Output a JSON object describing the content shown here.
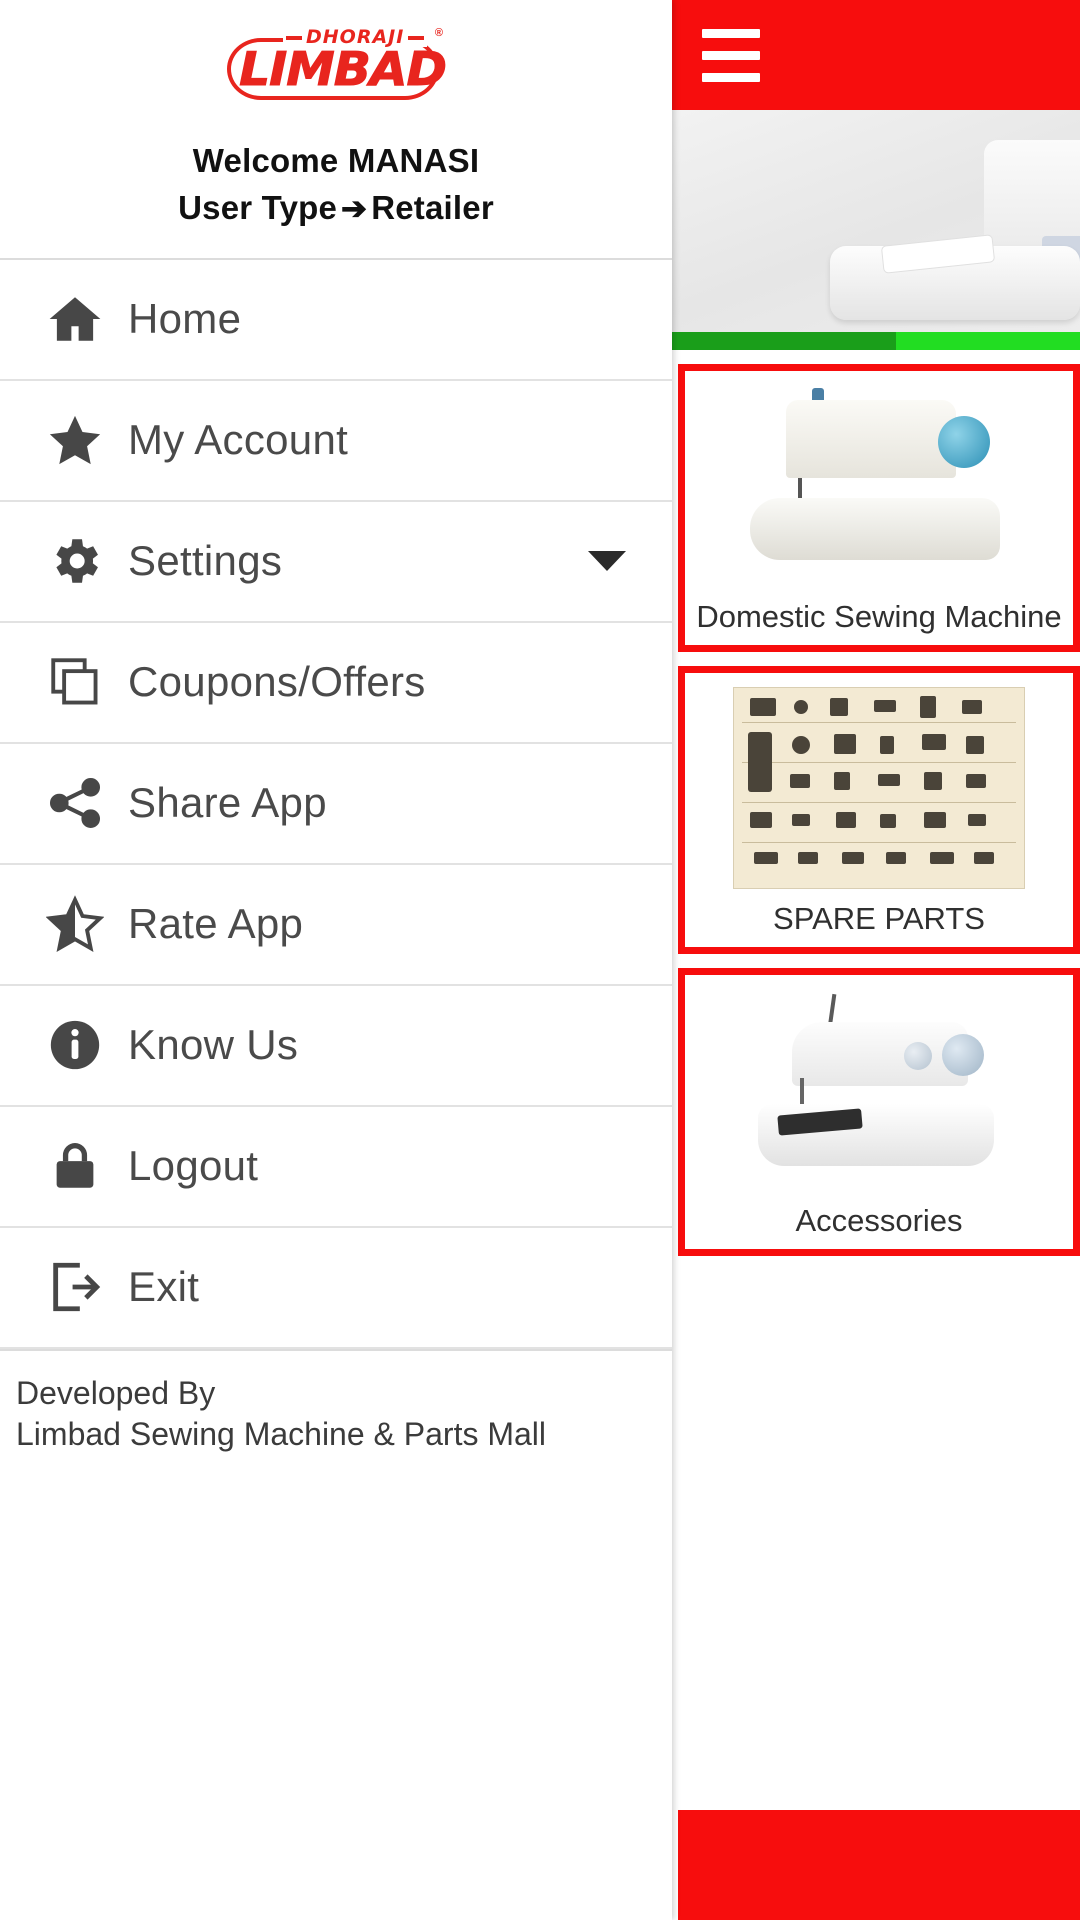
{
  "drawer": {
    "logo": {
      "top_text": "DHORAJI",
      "main_text": "LIMBAD",
      "registered_mark": "®",
      "color": "#e8251e",
      "icon": "dhoraji-limbad-logo"
    },
    "welcome_line": "Welcome MANASI",
    "user_type_label": "User Type",
    "user_type_arrow": "➔",
    "user_type_value": "Retailer",
    "menu_items": [
      {
        "label": "Home",
        "icon": "home-icon",
        "has_caret": false
      },
      {
        "label": "My Account",
        "icon": "star-icon",
        "has_caret": false
      },
      {
        "label": "Settings",
        "icon": "gear-icon",
        "has_caret": true
      },
      {
        "label": "Coupons/Offers",
        "icon": "copy-pages-icon",
        "has_caret": false
      },
      {
        "label": "Share App",
        "icon": "share-icon",
        "has_caret": false
      },
      {
        "label": "Rate App",
        "icon": "half-star-icon",
        "has_caret": false
      },
      {
        "label": "Know Us",
        "icon": "info-circle-icon",
        "has_caret": false
      },
      {
        "label": "Logout",
        "icon": "lock-icon",
        "has_caret": false
      },
      {
        "label": "Exit",
        "icon": "exit-arrow-icon",
        "has_caret": false
      }
    ],
    "footer": {
      "line1": "Developed By",
      "line2": "Limbad Sewing Machine & Parts Mall"
    }
  },
  "content": {
    "appbar": {
      "menu_icon": "hamburger-icon",
      "background_color": "#f70d0d"
    },
    "banner": {
      "image_alt": "white-sewing-machine-banner"
    },
    "progress_segments": [
      {
        "color": "#1a9e1a",
        "width_pct": 55
      },
      {
        "color": "#22dd22",
        "width_pct": 45
      }
    ],
    "cards": [
      {
        "caption": "Domestic Sewing Machine",
        "image_alt": "domestic-sewing-machine",
        "border_color": "#f70d0d"
      },
      {
        "caption": "SPARE PARTS",
        "image_alt": "spare-parts-chart",
        "border_color": "#f70d0d"
      },
      {
        "caption": "Accessories",
        "image_alt": "mini-sewing-machine",
        "border_color": "#f70d0d"
      }
    ]
  }
}
